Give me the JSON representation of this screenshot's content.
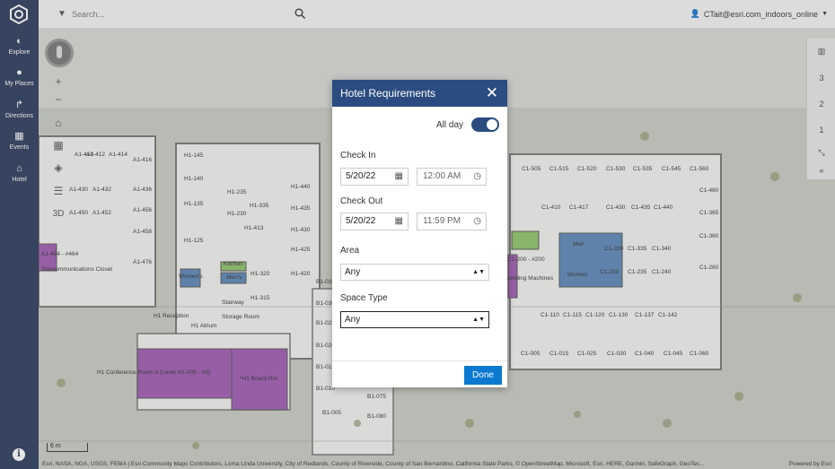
{
  "search": {
    "placeholder": "Search..."
  },
  "user": {
    "name": "CTait@esri.com_indoors_online"
  },
  "nav": [
    {
      "label": "Explore",
      "icon": "compass-icon"
    },
    {
      "label": "My Places",
      "icon": "pin-icon"
    },
    {
      "label": "Directions",
      "icon": "directions-icon"
    },
    {
      "label": "Events",
      "icon": "calendar-icon"
    },
    {
      "label": "Hotel",
      "icon": "hotel-icon"
    }
  ],
  "map": {
    "tool_3d": "3D",
    "floors": [
      "3",
      "2",
      "1"
    ],
    "selected_floor": "1",
    "scale": "6 m",
    "attribution": "Esri, NASA, NGA, USGS, FEMA | Esri Community Maps Contributors, Loma Linda University, City of Redlands, County of Riverside, County of San Bernardino, California State Parks, © OpenStreetMap, Microsoft, Esri, HERE, Garmin, SafeGraph, GeoTec...",
    "powered_by": "Powered by Esri",
    "rooms": [
      "A1-410",
      "A1-412",
      "A1-414",
      "A1-416",
      "A1-430",
      "A1-432",
      "A1-436",
      "A1-450",
      "A1-452",
      "A1-456",
      "A1-458",
      "A1-476",
      "H1-145",
      "H1-140",
      "H1-135",
      "H1-235",
      "H1-230",
      "H1-335",
      "H1-413",
      "H1-125",
      "H1-440",
      "H1-435",
      "H1-430",
      "H1-425",
      "H1-420",
      "H1-320",
      "H1-315",
      "Kitchen",
      "Men's",
      "Women's",
      "Stairway",
      "Storage Room",
      "H1 Reception",
      "H1 Atrium",
      "H1 Conference Room A (Level H1-005 - #5)",
      "*H1 Board Rm",
      "B1-035",
      "B1-030",
      "B1-025",
      "B1-020",
      "B1-015",
      "B1-010",
      "B1-005",
      "B1-075",
      "B1-080",
      "C1-505",
      "C1-515",
      "C1-520",
      "C1-530",
      "C1-535",
      "C1-545",
      "C1-560",
      "C1-410",
      "C1-417",
      "C1-430",
      "C1-435",
      "C1-440",
      "C1-460",
      "C1-365",
      "C1-360",
      "C1-330",
      "C1-335",
      "C1-340",
      "C1-260",
      "C1-230",
      "C1-235",
      "C1-240",
      "C1-110",
      "C1-115",
      "C1-120",
      "C1-130",
      "C1-137",
      "C1-142",
      "C1-005",
      "C1-015",
      "C1-025",
      "C1-030",
      "C1-040",
      "C1-045",
      "C1-060",
      "Men",
      "Women",
      "A1-464 - #464",
      "Telecommunications Closet",
      "C1-200 - #200",
      "Vending Machines"
    ]
  },
  "modal": {
    "title": "Hotel Requirements",
    "all_day_label": "All day",
    "all_day": true,
    "check_in_label": "Check In",
    "check_in_date": "5/20/22",
    "check_in_time": "12:00 AM",
    "check_out_label": "Check Out",
    "check_out_date": "5/20/22",
    "check_out_time": "11:59 PM",
    "area_label": "Area",
    "area_value": "Any",
    "space_type_label": "Space Type",
    "space_type_value": "Any",
    "done_label": "Done"
  },
  "colors": {
    "brand": "#2b3b5c",
    "header": "#2b4c80",
    "done": "#0b79d0",
    "conference": "#a05bb3",
    "restroom": "#5b87b8",
    "kitchen": "#8fc46b"
  }
}
